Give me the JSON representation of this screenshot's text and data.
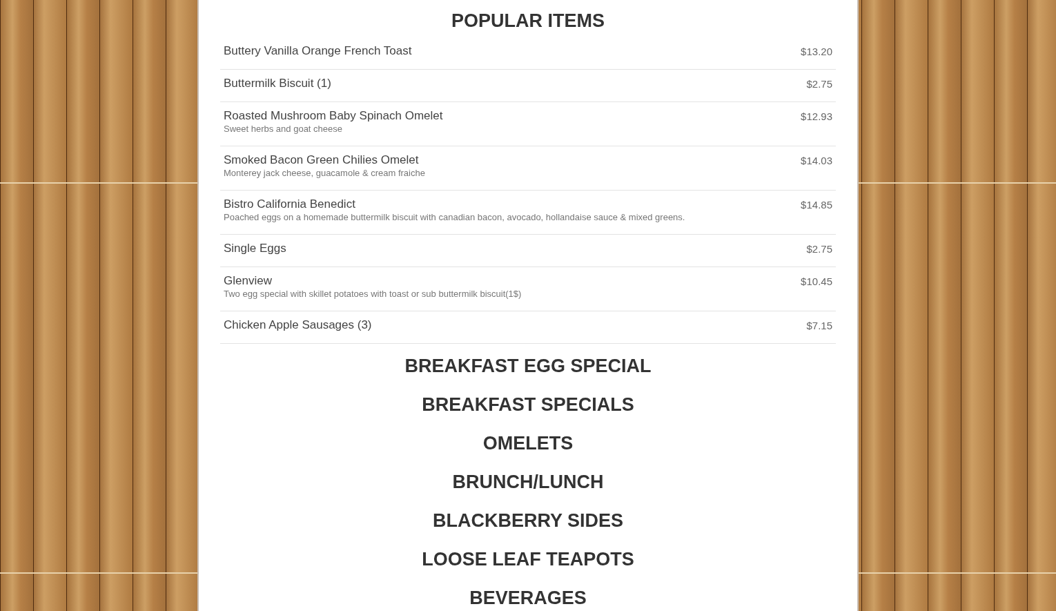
{
  "popular_items": {
    "title": "POPULAR ITEMS",
    "items": [
      {
        "name": "Buttery Vanilla Orange French Toast",
        "price": "$13.20"
      },
      {
        "name": "Buttermilk Biscuit (1)",
        "price": "$2.75"
      },
      {
        "name": "Roasted Mushroom Baby Spinach Omelet",
        "description": "Sweet herbs and goat cheese",
        "price": "$12.93"
      },
      {
        "name": "Smoked Bacon Green Chilies Omelet",
        "description": "Monterey jack cheese, guacamole & cream fraiche",
        "price": "$14.03"
      },
      {
        "name": "Bistro California Benedict",
        "description": "Poached eggs on a homemade buttermilk biscuit with canadian bacon, avocado, hollandaise sauce & mixed greens.",
        "price": "$14.85"
      },
      {
        "name": "Single Eggs",
        "price": "$2.75"
      },
      {
        "name": "Glenview",
        "description": "Two egg special with skillet potatoes with toast or sub buttermilk biscuit(1$)",
        "price": "$10.45"
      },
      {
        "name": "Chicken Apple Sausages (3)",
        "price": "$7.15"
      }
    ]
  },
  "sections": [
    {
      "title": "BREAKFAST EGG SPECIAL"
    },
    {
      "title": "BREAKFAST SPECIALS"
    },
    {
      "title": "OMELETS"
    },
    {
      "title": "BRUNCH/LUNCH"
    },
    {
      "title": "BLACKBERRY SIDES"
    },
    {
      "title": "LOOSE LEAF TEAPOTS"
    },
    {
      "title": "BEVERAGES"
    }
  ]
}
